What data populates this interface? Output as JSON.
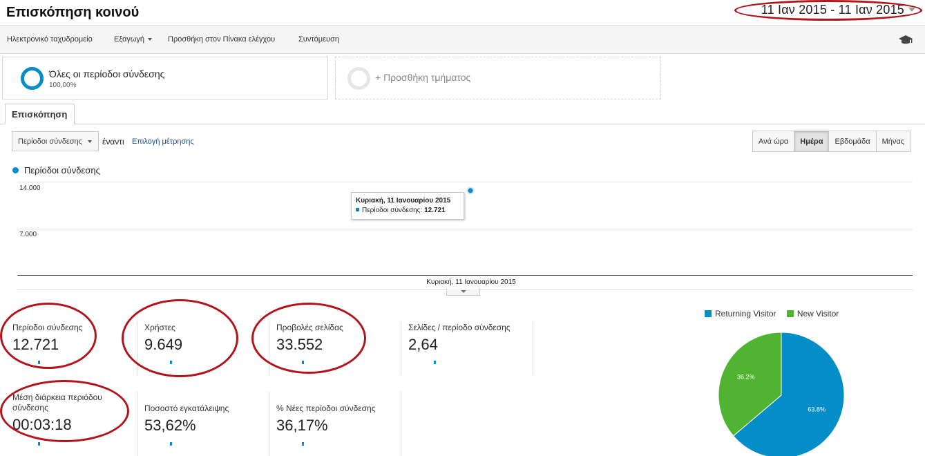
{
  "header": {
    "title": "Επισκόπηση κοινού",
    "date_range": "11 Ιαν 2015 - 11 Ιαν 2015"
  },
  "toolbar": {
    "email": "Ηλεκτρονικό ταχυδρομείο",
    "export": "Εξαγωγή",
    "add_to_dashboard": "Προσθήκη στον Πίνακα ελέγχου",
    "shortcut": "Συντόμευση"
  },
  "segments": {
    "main_name": "Όλες οι περίοδοι σύνδεσης",
    "main_pct": "100,00%",
    "add_label": "+ Προσθήκη τμήματος"
  },
  "tabs": {
    "overview": "Επισκόπηση"
  },
  "controls": {
    "metric_select": "Περίοδοι σύνδεσης",
    "vs": "έναντι",
    "pick_metric": "Επιλογή μέτρησης",
    "periods": [
      {
        "label": "Ανά ώρα",
        "active": false
      },
      {
        "label": "Ημέρα",
        "active": true
      },
      {
        "label": "Εβδομάδα",
        "active": false
      },
      {
        "label": "Μήνας",
        "active": false
      }
    ]
  },
  "chart": {
    "legend": "Περίοδοι σύνδεσης",
    "y_ticks": [
      "14.000",
      "7.000"
    ],
    "x_label": "Κυριακή, 11 Ιανουαρίου 2015",
    "tooltip_title": "Κυριακή, 11 Ιανουαρίου 2015",
    "tooltip_series": "Περίοδοι σύνδεσης:",
    "tooltip_value": "12.721",
    "point_value": 12721,
    "y_max": 14000,
    "series_color": "#058dc7"
  },
  "metrics": [
    {
      "label": "Περίοδοι σύνδεσης",
      "value": "12.721"
    },
    {
      "label": "Χρήστες",
      "value": "9.649"
    },
    {
      "label": "Προβολές σελίδας",
      "value": "33.552"
    },
    {
      "label": "Σελίδες / περίοδο σύνδεσης",
      "value": "2,64"
    },
    {
      "label": "Μέση διάρκεια περιόδου σύνδεσης",
      "value": "00:03:18"
    },
    {
      "label": "Ποσοστό εγκατάλειψης",
      "value": "53,62%"
    },
    {
      "label": "% Νέες περίοδοι σύνδεσης",
      "value": "36,17%"
    }
  ],
  "chart_data": {
    "type": "pie",
    "categories": [
      "Returning Visitor",
      "New Visitor"
    ],
    "values": [
      63.8,
      36.2
    ],
    "labels": [
      "63.8%",
      "36.2%"
    ],
    "colors": [
      "#058dc7",
      "#50b432"
    ],
    "legend_position": "top"
  }
}
